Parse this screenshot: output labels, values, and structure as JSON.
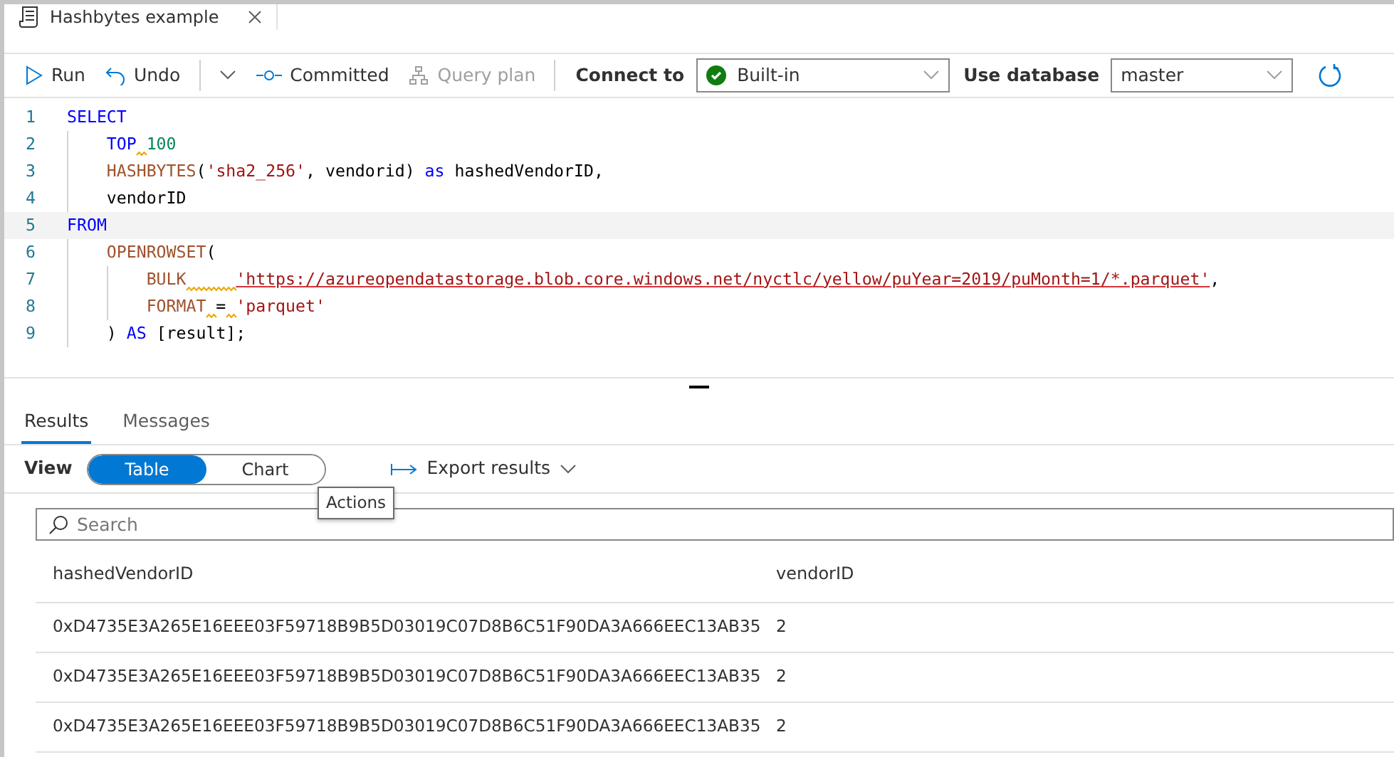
{
  "tab": {
    "title": "Hashbytes example"
  },
  "toolbar": {
    "run": "Run",
    "undo": "Undo",
    "committed": "Committed",
    "query_plan": {
      "label": "Query plan",
      "disabled": true
    },
    "connect_label": "Connect to",
    "connect_value": "Built-in",
    "database_label": "Use database",
    "database_value": "master"
  },
  "editor": {
    "lines": [
      {
        "number": "1",
        "current": false,
        "tokens": [
          {
            "kind": "keyword",
            "text": "SELECT"
          }
        ]
      },
      {
        "number": "2",
        "current": false,
        "tokens": [
          {
            "kind": "indent"
          },
          {
            "kind": "keyword",
            "text": "TOP"
          },
          {
            "kind": "warning_gap",
            "wide": false
          },
          {
            "kind": "number",
            "text": "100"
          }
        ]
      },
      {
        "number": "3",
        "current": false,
        "tokens": [
          {
            "kind": "indent"
          },
          {
            "kind": "function",
            "text": "HASHBYTES"
          },
          {
            "kind": "plain",
            "text": "("
          },
          {
            "kind": "string",
            "text": "'sha2_256'"
          },
          {
            "kind": "plain",
            "text": ", vendorid) "
          },
          {
            "kind": "keyword",
            "text": "as"
          },
          {
            "kind": "plain",
            "text": " hashedVendorID,"
          }
        ]
      },
      {
        "number": "4",
        "current": false,
        "tokens": [
          {
            "kind": "indent"
          },
          {
            "kind": "plain",
            "text": "vendorID"
          }
        ]
      },
      {
        "number": "5",
        "current": true,
        "tokens": [
          {
            "kind": "keyword",
            "text": "FROM"
          }
        ]
      },
      {
        "number": "6",
        "current": false,
        "tokens": [
          {
            "kind": "indent"
          },
          {
            "kind": "function",
            "text": "OPENROWSET"
          },
          {
            "kind": "plain",
            "text": "("
          }
        ]
      },
      {
        "number": "7",
        "current": false,
        "tokens": [
          {
            "kind": "indent"
          },
          {
            "kind": "indent"
          },
          {
            "kind": "function",
            "text": "BULK"
          },
          {
            "kind": "warning_gap",
            "wide": true
          },
          {
            "kind": "error_string",
            "text": "'https://azureopendatastorage.blob.core.windows.net/nyctlc/yellow/puYear=2019/puMonth=1/*.parquet'"
          },
          {
            "kind": "plain",
            "text": ","
          }
        ]
      },
      {
        "number": "8",
        "current": false,
        "tokens": [
          {
            "kind": "indent"
          },
          {
            "kind": "indent"
          },
          {
            "kind": "function",
            "text": "FORMAT"
          },
          {
            "kind": "warning_gap",
            "wide": false
          },
          {
            "kind": "plain",
            "text": "="
          },
          {
            "kind": "warning_gap",
            "wide": false
          },
          {
            "kind": "string",
            "text": "'parquet'"
          }
        ]
      },
      {
        "number": "9",
        "current": false,
        "tokens": [
          {
            "kind": "indent"
          },
          {
            "kind": "plain",
            "text": ") "
          },
          {
            "kind": "keyword",
            "text": "AS"
          },
          {
            "kind": "plain",
            "text": " [result];"
          }
        ]
      }
    ]
  },
  "result_tabs": [
    {
      "label": "Results",
      "selected": true
    },
    {
      "label": "Messages",
      "selected": false
    }
  ],
  "view": {
    "label": "View",
    "options": [
      {
        "label": "Table",
        "selected": true
      },
      {
        "label": "Chart",
        "selected": false
      }
    ],
    "export": "Export results",
    "tooltip": "Actions"
  },
  "search": {
    "placeholder": "Search"
  },
  "table": {
    "columns": [
      "hashedVendorID",
      "vendorID"
    ],
    "rows": [
      [
        "0xD4735E3A265E16EEE03F59718B9B5D03019C07D8B6C51F90DA3A666EEC13AB35",
        "2"
      ],
      [
        "0xD4735E3A265E16EEE03F59718B9B5D03019C07D8B6C51F90DA3A666EEC13AB35",
        "2"
      ],
      [
        "0xD4735E3A265E16EEE03F59718B9B5D03019C07D8B6C51F90DA3A666EEC13AB35",
        "2"
      ]
    ]
  }
}
